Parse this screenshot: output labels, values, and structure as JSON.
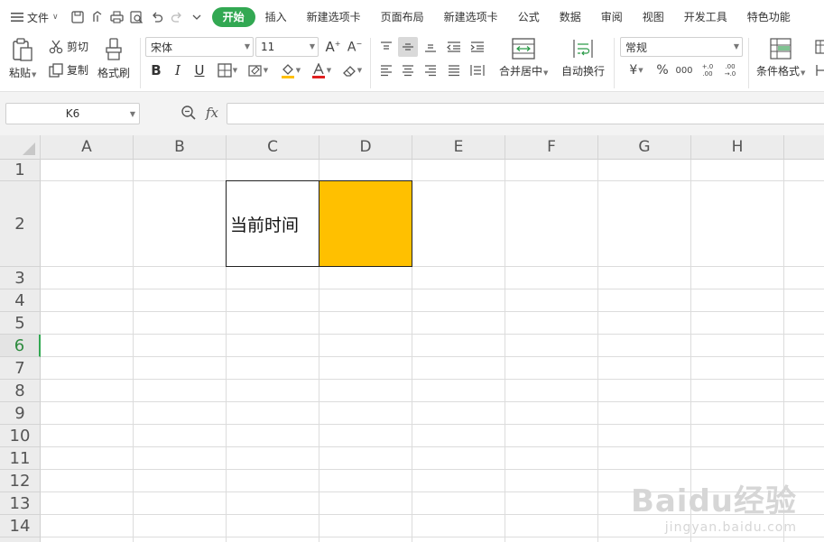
{
  "menu": {
    "file_label": "文件",
    "tabs": [
      {
        "label": "开始",
        "active": true
      },
      {
        "label": "插入"
      },
      {
        "label": "新建选项卡"
      },
      {
        "label": "页面布局"
      },
      {
        "label": "新建选项卡"
      },
      {
        "label": "公式"
      },
      {
        "label": "数据"
      },
      {
        "label": "审阅"
      },
      {
        "label": "视图"
      },
      {
        "label": "开发工具"
      },
      {
        "label": "特色功能"
      }
    ]
  },
  "ribbon": {
    "paste": "粘贴",
    "cut": "剪切",
    "copy": "复制",
    "format_painter": "格式刷",
    "font_name": "宋体",
    "font_size": "11",
    "merge_center": "合并居中",
    "wrap_text": "自动换行",
    "number_format": "常规",
    "conditional_format": "条件格式",
    "currency_symbol": "¥",
    "percent_symbol": "%",
    "thousands_symbol": "000",
    "increase_decimal": "+.0 .00",
    "decrease_decimal": ".00 →.0"
  },
  "formula_bar": {
    "name_box": "K6",
    "fx_label": "fx",
    "formula": ""
  },
  "sheet": {
    "columns": [
      "A",
      "B",
      "C",
      "D",
      "E",
      "F",
      "G",
      "H"
    ],
    "rows": [
      "1",
      "2",
      "3",
      "4",
      "5",
      "6",
      "7",
      "8",
      "9",
      "10",
      "11",
      "12",
      "13",
      "14"
    ],
    "active_row": "6",
    "cells": {
      "C2": "当前时间",
      "D2": ""
    },
    "d2_fill": "#FFC000"
  },
  "watermark": {
    "brand": "Baidu经验",
    "url": "jingyan.baidu.com"
  },
  "colors": {
    "accent": "#32A852",
    "d2_fill": "#FFC000"
  }
}
